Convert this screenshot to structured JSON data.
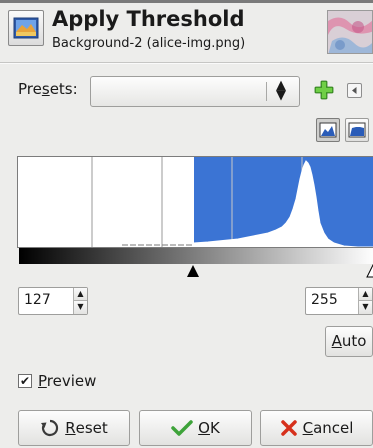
{
  "header": {
    "title": "Apply Threshold",
    "subtitle": "Background-2 (alice-img.png)",
    "icon": "threshold-tool-icon"
  },
  "presets": {
    "label_prefix": "Pre",
    "label_mnemonic": "s",
    "label_suffix": "ets:",
    "value": "",
    "add_icon": "add-preset-icon",
    "menu_icon": "preset-menu-icon"
  },
  "histogram": {
    "scale_buttons": [
      "linear-histogram-icon",
      "logarithmic-histogram-icon"
    ],
    "active_scale": "linear",
    "selection_color": "#3b74d4"
  },
  "threshold": {
    "low": "127",
    "high": "255"
  },
  "auto_button": {
    "mnemonic": "A",
    "rest": "uto"
  },
  "preview": {
    "checked": true,
    "check_glyph": "✔",
    "mnemonic": "P",
    "rest": "review"
  },
  "buttons": {
    "reset": {
      "mnemonic": "R",
      "rest": "eset",
      "icon": "reset-icon"
    },
    "ok": {
      "mnemonic": "O",
      "rest": "K",
      "icon": "checkmark-icon",
      "icon_color": "#3ea33a"
    },
    "cancel": {
      "mnemonic": "C",
      "rest": "ancel",
      "icon": "cancel-x-icon",
      "icon_color": "#d6301c"
    }
  }
}
